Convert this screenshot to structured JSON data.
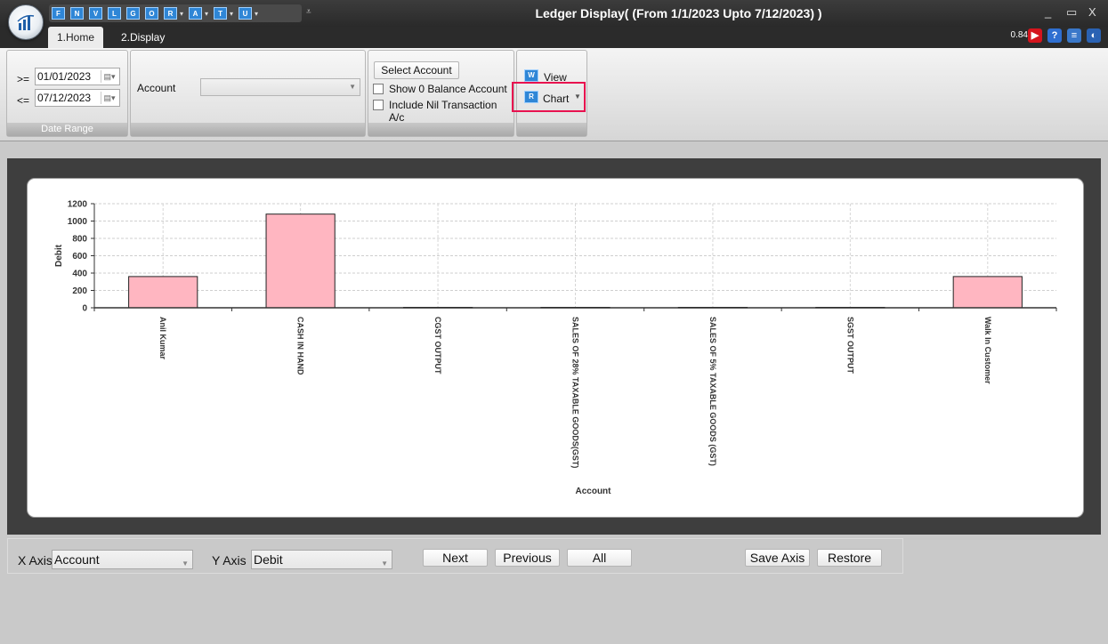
{
  "window": {
    "title": "Ledger Display( (From 1/1/2023 Upto 7/12/2023) )",
    "minimize": "_",
    "maximize": "▭",
    "close": "X"
  },
  "quick_access": [
    "F",
    "N",
    "V",
    "L",
    "G",
    "O",
    "R",
    "A",
    "T",
    "U"
  ],
  "tabs": [
    {
      "label": "1.Home",
      "active": true
    },
    {
      "label": "2.Display",
      "active": false
    }
  ],
  "zoom_text": "0.84",
  "ribbon": {
    "date_range": {
      "from_op": ">=",
      "from_value": "01/01/2023",
      "to_op": "<=",
      "to_value": "07/12/2023",
      "caption": "Date Range"
    },
    "account": {
      "label": "Account",
      "value": ""
    },
    "select_account_label": "Select Account",
    "show_zero_balance_label": "Show 0 Balance Account",
    "show_zero_balance_checked": false,
    "include_nil_label": "Include Nil Transaction A/c",
    "include_nil_checked": false,
    "view_label": "View",
    "chart_label": "Chart"
  },
  "chart_data": {
    "type": "bar",
    "categories": [
      "Anil Kumar",
      "CASH IN HAND",
      "CGST OUTPUT",
      "SALES OF 28% TAXABLE GOODS(GST)",
      "SALES OF 5% TAXABLE GOODS (GST)",
      "SGST OUTPUT",
      "Walk In Customer"
    ],
    "values": [
      360,
      1080,
      5,
      5,
      5,
      5,
      360
    ],
    "xlabel": "Account",
    "ylabel": "Debit",
    "ylim": [
      0,
      1200
    ],
    "yticks": [
      "0",
      "200",
      "400",
      "600",
      "800",
      "1000",
      "1200"
    ],
    "bar_color": "#ffb6c1",
    "grid": true
  },
  "axis_controls": {
    "x_label": "X Axis",
    "x_value": "Account",
    "y_label": "Y Axis",
    "y_value": "Debit",
    "next": "Next",
    "previous": "Previous",
    "all": "All",
    "save_axis": "Save Axis",
    "restore": "Restore"
  }
}
